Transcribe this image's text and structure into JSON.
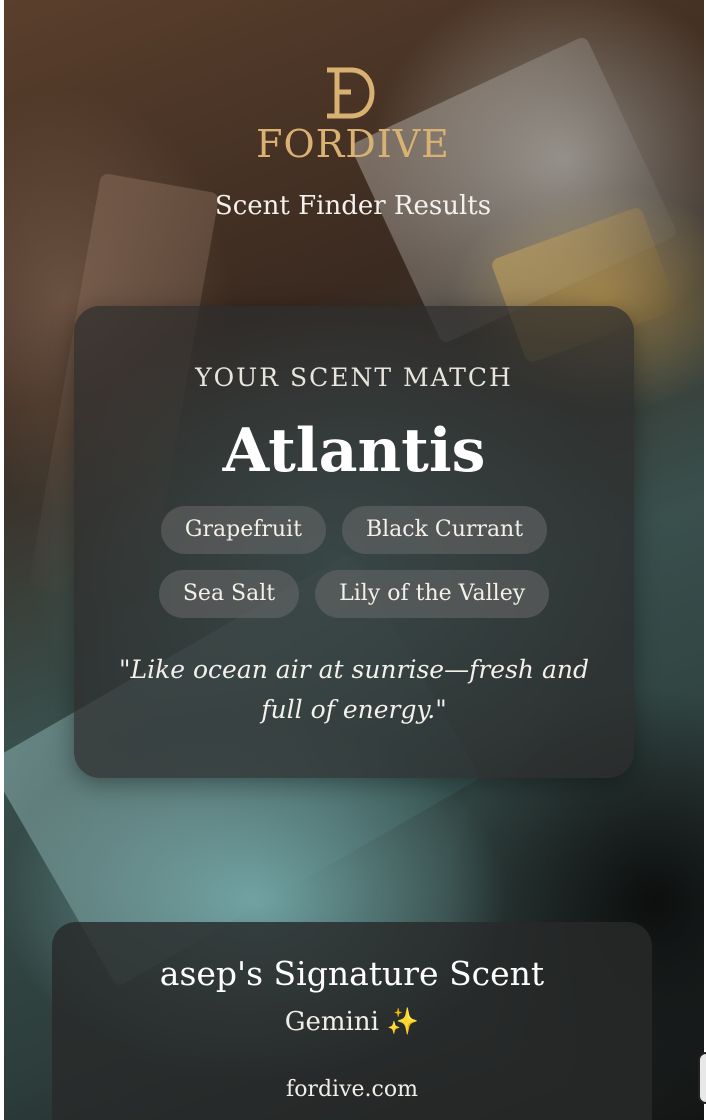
{
  "brand": {
    "name": "FORDIVE",
    "logo_icon": "fd-monogram-icon",
    "accent_color": "#d9b273"
  },
  "header": {
    "subtitle": "Scent Finder Results"
  },
  "match": {
    "label": "YOUR SCENT MATCH",
    "scent_name": "Atlantis",
    "notes": [
      "Grapefruit",
      "Black Currant",
      "Sea Salt",
      "Lily of the Valley"
    ],
    "quote": "\"Like ocean air at sunrise—fresh and full of energy.\""
  },
  "signature": {
    "title": "asep's Signature Scent",
    "zodiac": "Gemini",
    "sparkle_icon": "sparkles-icon",
    "sparkle_glyph": "✨",
    "website": "fordive.com"
  }
}
